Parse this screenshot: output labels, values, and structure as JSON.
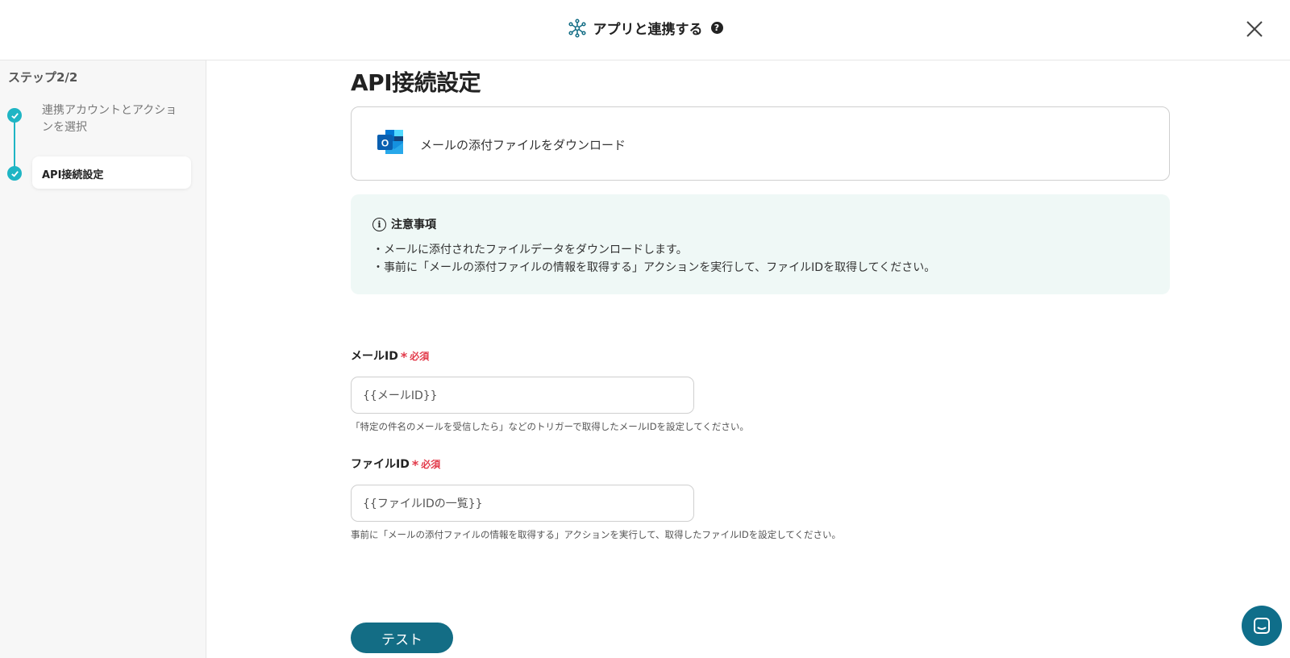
{
  "header": {
    "title": "アプリと連携する",
    "help_icon": "question-circle-icon",
    "close_icon": "close-icon"
  },
  "sidebar": {
    "step_count": "ステップ2/2",
    "steps": [
      {
        "label": "連携アカウントとアクションを選択",
        "status": "completed"
      },
      {
        "label": "API接続設定",
        "status": "current"
      }
    ]
  },
  "main": {
    "page_title": "API接続設定",
    "action": {
      "icon": "outlook-icon",
      "label": "メールの添付ファイルをダウンロード"
    },
    "notice": {
      "title": "注意事項",
      "lines": [
        "・メールに添付されたファイルデータをダウンロードします。",
        "・事前に「メールの添付ファイルの情報を取得する」アクションを実行して、ファイルIDを取得してください。"
      ]
    },
    "fields": [
      {
        "label": "メールID",
        "required_text": "必須",
        "value": "{{メールID}}",
        "hint": "「特定の件名のメールを受信したら」などのトリガーで取得したメールIDを設定してください。"
      },
      {
        "label": "ファイルID",
        "required_text": "必須",
        "value": "{{ファイルIDの一覧}}",
        "hint": "事前に「メールの添付ファイルの情報を取得する」アクションを実行して、取得したファイルIDを設定してください。"
      }
    ],
    "test_button": "テスト"
  },
  "colors": {
    "accent_teal": "#1fb5c4",
    "button_primary": "#136d85",
    "required_red": "#e23a4a",
    "notice_bg": "#eff8f6"
  }
}
